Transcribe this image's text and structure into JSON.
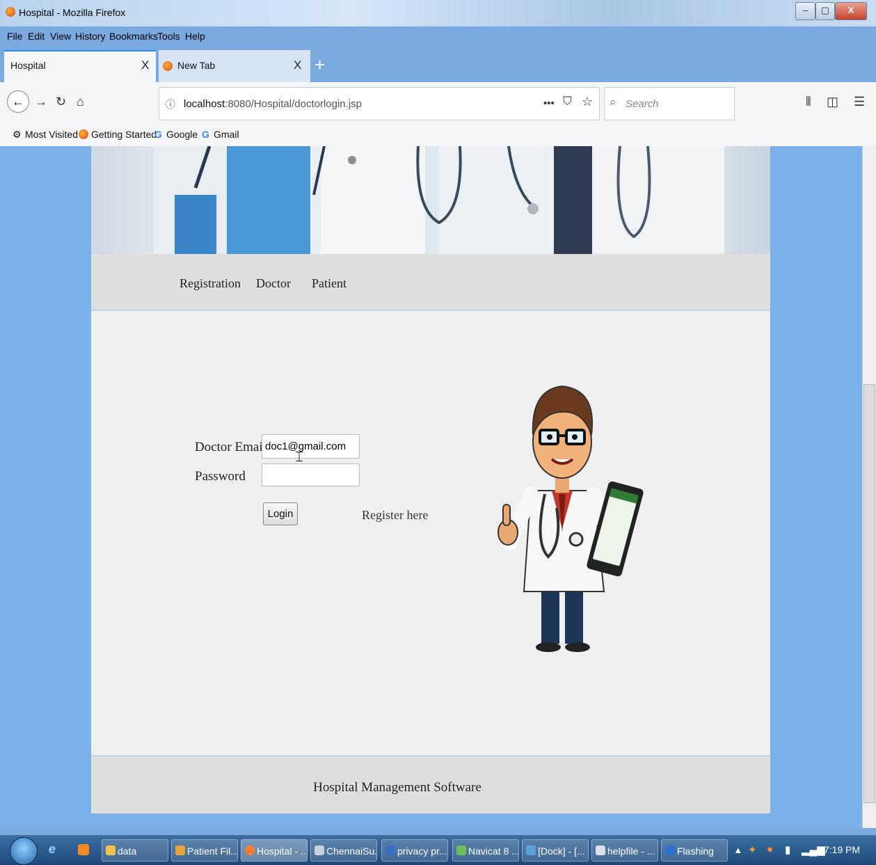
{
  "window": {
    "title": "Hospital - Mozilla Firefox",
    "controls": {
      "minimize": "–",
      "maximize": "▢",
      "close": "X"
    }
  },
  "menubar": [
    "File",
    "Edit",
    "View",
    "History",
    "Bookmarks",
    "Tools",
    "Help"
  ],
  "tabs": [
    {
      "label": "Hospital",
      "close": "X",
      "active": true
    },
    {
      "label": "New Tab",
      "close": "X",
      "active": false
    }
  ],
  "new_tab": "+",
  "navbar": {
    "url_host": "localhost",
    "url_rest": ":8080/Hospital/doctorlogin.jsp",
    "page_actions": "•••",
    "search_placeholder": "Search"
  },
  "bookmarks": [
    "Most Visited",
    "Getting Started",
    "Google",
    "Gmail"
  ],
  "site": {
    "nav": [
      "Registration",
      "Doctor",
      "Patient"
    ],
    "form": {
      "email_label": "Doctor Email",
      "email_value": "doc1@gmail.com",
      "password_label": "Password",
      "password_value": "",
      "login_label": "Login",
      "register_label": "Register here"
    },
    "footer": "Hospital Management Software"
  },
  "taskbar": {
    "items": [
      "data",
      "Patient Fil...",
      "Hospital - ...",
      "ChennaiSu...",
      "privacy pr...",
      "Navicat 8 ...",
      "[Dock] - [...",
      "helpfile - ...",
      "Flashing"
    ],
    "active_item": "Hospital - ...",
    "clock": "7:19 PM"
  },
  "colors": {
    "page_bg": "#7cb0ea",
    "content_bg": "#f0f0f0",
    "strip_bg": "#dedede",
    "taskbar": "#1e4a7a"
  }
}
